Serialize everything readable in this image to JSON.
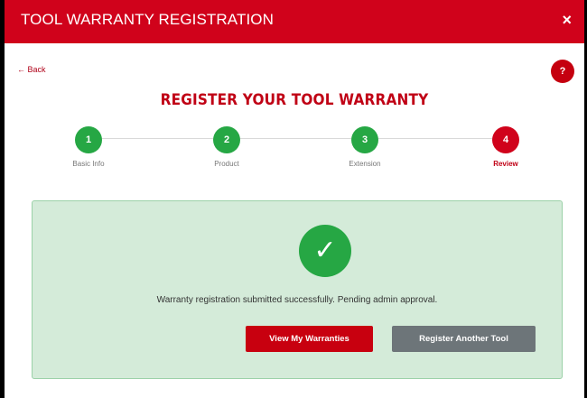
{
  "window": {
    "title": "TOOL WARRANTY REGISTRATION",
    "close_glyph": "×"
  },
  "nav": {
    "back_label": "← Back",
    "help_label": "?"
  },
  "page": {
    "heading": "REGISTER YOUR TOOL WARRANTY"
  },
  "stepper": {
    "current_step": 4,
    "steps": [
      {
        "number": "1",
        "label": "Basic Info",
        "status": "complete"
      },
      {
        "number": "2",
        "label": "Product",
        "status": "complete"
      },
      {
        "number": "3",
        "label": "Extension",
        "status": "complete"
      },
      {
        "number": "4",
        "label": "Review",
        "status": "current"
      }
    ]
  },
  "success": {
    "icon": "checkmark-icon",
    "icon_glyph": "✓",
    "message": "Warranty registration submitted successfully. Pending admin approval.",
    "primary_button": "View My Warranties",
    "secondary_button": "Register Another Tool"
  },
  "colors": {
    "brand_red": "#d0021b",
    "success_green": "#26a744",
    "panel_bg": "#d4ebd9",
    "secondary_gray": "#6d7579"
  }
}
